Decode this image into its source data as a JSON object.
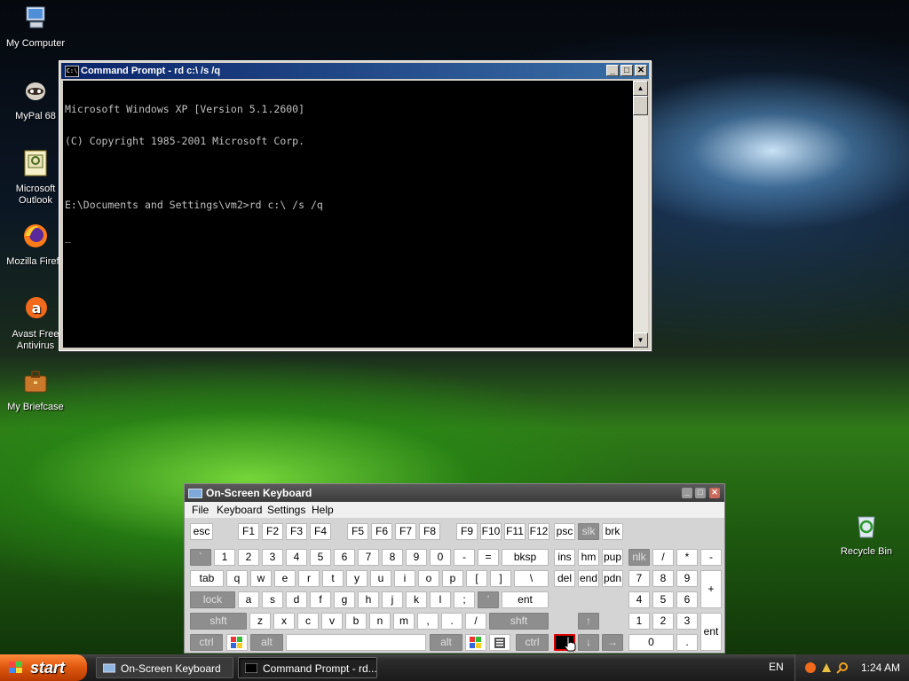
{
  "desktop": {
    "icons": [
      {
        "label": "My Computer",
        "icon": "computer-icon"
      },
      {
        "label": "MyPal 68",
        "icon": "mypal-icon"
      },
      {
        "label": "Microsoft\nOutlook",
        "icon": "outlook-icon"
      },
      {
        "label": "Mozilla Firefo",
        "icon": "firefox-icon"
      },
      {
        "label": "Avast Free\nAntivirus",
        "icon": "avast-icon"
      },
      {
        "label": "My Briefcase",
        "icon": "briefcase-icon"
      },
      {
        "label": "Recycle Bin",
        "icon": "recycle-bin-icon"
      }
    ]
  },
  "cmd": {
    "title": "Command Prompt - rd c:\\ /s /q",
    "lines": [
      "Microsoft Windows XP [Version 5.1.2600]",
      "(C) Copyright 1985-2001 Microsoft Corp.",
      "",
      "E:\\Documents and Settings\\vm2>rd c:\\ /s /q",
      "_"
    ],
    "buttons": {
      "minimize": "_",
      "maximize": "□",
      "close": "✕"
    }
  },
  "osk": {
    "title": "On-Screen Keyboard",
    "menu": [
      "File",
      "Keyboard",
      "Settings",
      "Help"
    ],
    "rows": {
      "fn": [
        "esc",
        "F1",
        "F2",
        "F3",
        "F4",
        "F5",
        "F6",
        "F7",
        "F8",
        "F9",
        "F10",
        "F11",
        "F12",
        "psc",
        "slk",
        "brk"
      ],
      "num": [
        "`",
        "1",
        "2",
        "3",
        "4",
        "5",
        "6",
        "7",
        "8",
        "9",
        "0",
        "-",
        "=",
        "bksp",
        "ins",
        "hm",
        "pup",
        "nlk",
        "/",
        "*",
        "-"
      ],
      "q": [
        "tab",
        "q",
        "w",
        "e",
        "r",
        "t",
        "y",
        "u",
        "i",
        "o",
        "p",
        "[",
        "]",
        "\\",
        "del",
        "end",
        "pdn",
        "7",
        "8",
        "9",
        "+"
      ],
      "a": [
        "lock",
        "a",
        "s",
        "d",
        "f",
        "g",
        "h",
        "j",
        "k",
        "l",
        ";",
        "'",
        "ent",
        "4",
        "5",
        "6"
      ],
      "z": [
        "shft",
        "z",
        "x",
        "c",
        "v",
        "b",
        "n",
        "m",
        ",",
        ".",
        "/",
        "shft",
        "↑",
        "1",
        "2",
        "3",
        "ent"
      ],
      "bottom": [
        "ctrl",
        "alt",
        "alt",
        "ctrl",
        "↓",
        "→",
        "0",
        "."
      ]
    }
  },
  "taskbar": {
    "start": "start",
    "tasks": [
      "On-Screen Keyboard",
      "Command Prompt - rd..."
    ],
    "language": "EN",
    "clock": "1:24 AM"
  }
}
